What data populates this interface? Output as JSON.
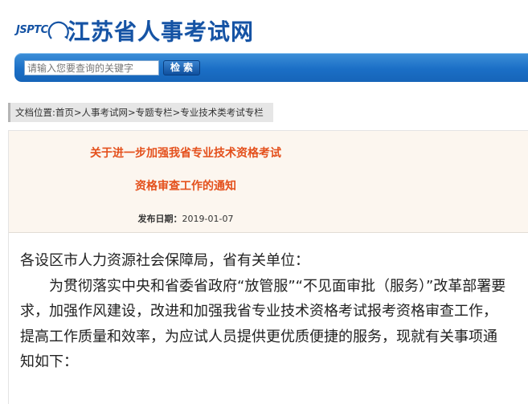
{
  "header": {
    "logo_abbr": "JSPTC",
    "site_title": "江苏省人事考试网"
  },
  "search": {
    "placeholder": "请输入您要查询的关键字",
    "button_label": "检索"
  },
  "breadcrumb": {
    "text": "文档位置:首页>人事考试网>专题专栏>专业技术类考试专栏"
  },
  "article": {
    "title_line1": "关于进一步加强我省专业技术资格考试",
    "title_line2": "资格审查工作的通知",
    "publish_label": "发布日期：",
    "publish_date": "2019-01-07",
    "salutation": "各设区市人力资源社会保障局，省有关单位：",
    "paragraph1": "为贯彻落实中央和省委省政府“放管服”“不见面审批（服务）”改革部署要求，加强作风建设，改进和加强我省专业技术资格考试报考资格审查工作，提高工作质量和效率，为应试人员提供更优质便捷的服务，现就有关事项通知如下："
  },
  "colors": {
    "brand_blue": "#1553a4",
    "title_orange": "#e4501c",
    "search_bar_blue": "#1b6fc6"
  }
}
